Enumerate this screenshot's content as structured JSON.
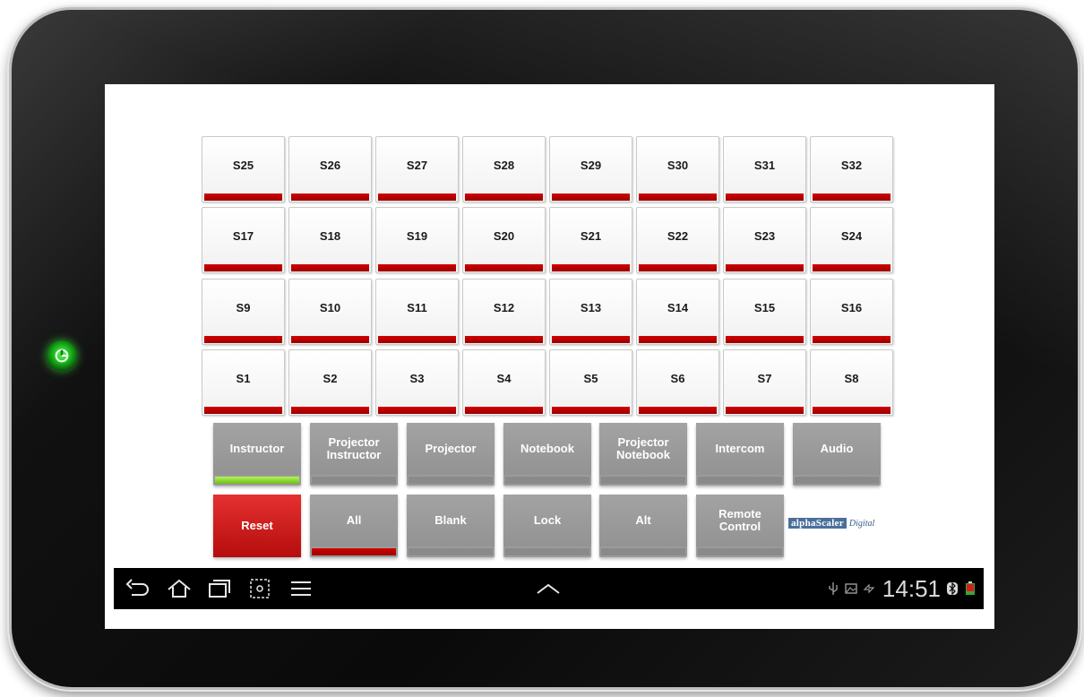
{
  "source_rows": [
    [
      "S25",
      "S26",
      "S27",
      "S28",
      "S29",
      "S30",
      "S31",
      "S32"
    ],
    [
      "S17",
      "S18",
      "S19",
      "S20",
      "S21",
      "S22",
      "S23",
      "S24"
    ],
    [
      "S9",
      "S10",
      "S11",
      "S12",
      "S13",
      "S14",
      "S15",
      "S16"
    ],
    [
      "S1",
      "S2",
      "S3",
      "S4",
      "S5",
      "S6",
      "S7",
      "S8"
    ]
  ],
  "mode_buttons": [
    {
      "label": "Instructor",
      "indicator": "green"
    },
    {
      "label": "Projector\nInstructor",
      "indicator": "gray"
    },
    {
      "label": "Projector",
      "indicator": "gray"
    },
    {
      "label": "Notebook",
      "indicator": "gray"
    },
    {
      "label": "Projector\nNotebook",
      "indicator": "gray"
    },
    {
      "label": "Intercom",
      "indicator": "gray"
    },
    {
      "label": "Audio",
      "indicator": "gray"
    }
  ],
  "control_buttons": [
    {
      "label": "Reset",
      "style": "red"
    },
    {
      "label": "All",
      "indicator": "red"
    },
    {
      "label": "Blank",
      "indicator": "gray"
    },
    {
      "label": "Lock",
      "indicator": "gray"
    },
    {
      "label": "Alt",
      "indicator": "gray"
    },
    {
      "label": "Remote\nControl",
      "indicator": "gray"
    }
  ],
  "logo": {
    "word": "alphaScaler",
    "sub": "Digital"
  },
  "status_bar": {
    "time": "14:51",
    "icons": [
      "usb-icon",
      "image-icon",
      "sync-icon",
      "bluetooth-icon",
      "battery-icon"
    ]
  },
  "nav_icons": [
    "back-icon",
    "home-icon",
    "recent-apps-icon",
    "screenshot-icon",
    "menu-icon",
    "chevron-up-icon"
  ],
  "colors": {
    "indicator_red": "#b00000",
    "indicator_green": "#8ad630",
    "button_gray": "#9b9b9b",
    "reset_red": "#d21e1e"
  }
}
